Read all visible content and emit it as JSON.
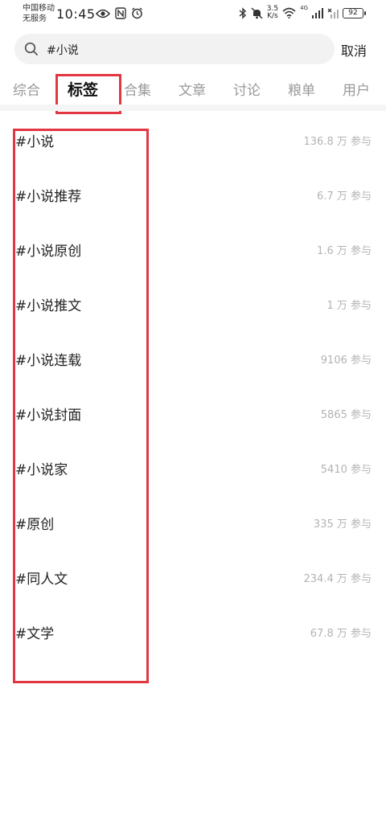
{
  "status_bar": {
    "carrier_line1": "中国移动",
    "carrier_line2": "无服务",
    "time": "10:45",
    "net_speed_value": "3.5",
    "net_speed_unit": "K/s",
    "signal_label": "4G",
    "battery": "92"
  },
  "search": {
    "query": "#小说",
    "cancel_label": "取消"
  },
  "tabs": [
    {
      "label": "综合"
    },
    {
      "label": "标签"
    },
    {
      "label": "合集"
    },
    {
      "label": "文章"
    },
    {
      "label": "讨论"
    },
    {
      "label": "粮单"
    },
    {
      "label": "用户"
    }
  ],
  "active_tab": "标签",
  "tags": [
    {
      "name": "#小说",
      "count": "136.8 万 参与"
    },
    {
      "name": "#小说推荐",
      "count": "6.7 万 参与"
    },
    {
      "name": "#小说原创",
      "count": "1.6 万 参与"
    },
    {
      "name": "#小说推文",
      "count": "1 万 参与"
    },
    {
      "name": "#小说连载",
      "count": "9106 参与"
    },
    {
      "name": "#小说封面",
      "count": "5865 参与"
    },
    {
      "name": "#小说家",
      "count": "5410 参与"
    },
    {
      "name": "#原创",
      "count": "335 万 参与"
    },
    {
      "name": "#同人文",
      "count": "234.4 万 参与"
    },
    {
      "name": "#文学",
      "count": "67.8 万 参与"
    }
  ],
  "colors": {
    "highlight": "#e23743",
    "muted_text": "#b3b3b3",
    "search_bg": "#f2f2f3"
  }
}
